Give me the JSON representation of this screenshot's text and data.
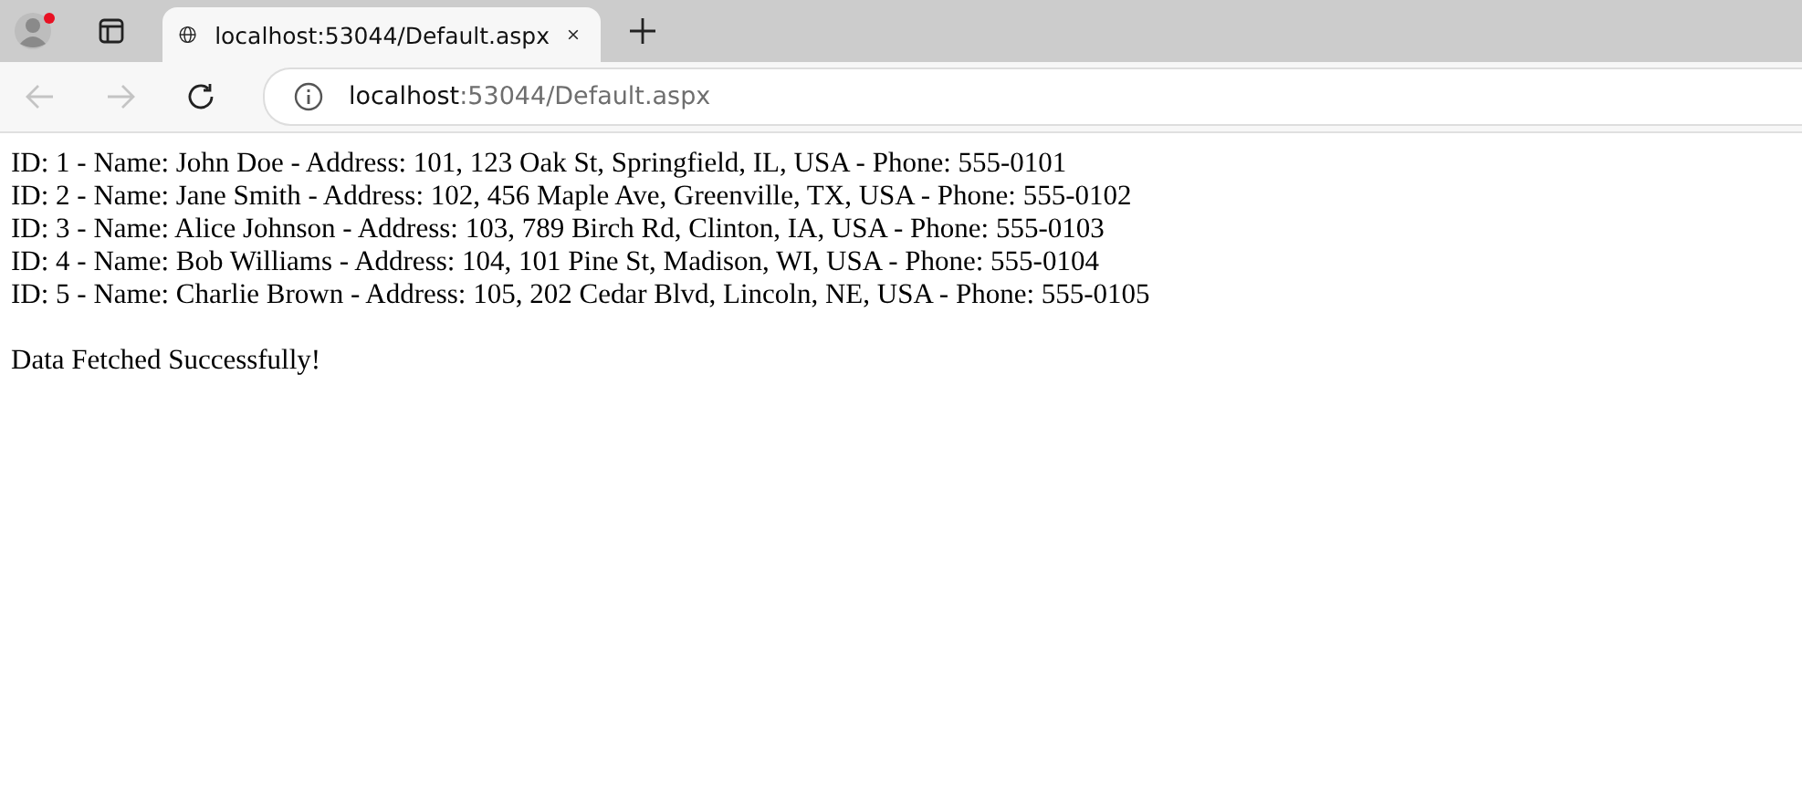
{
  "tab": {
    "title": "localhost:53044/Default.aspx",
    "selected": true
  },
  "toolbar": {
    "back_disabled": true,
    "forward_disabled": true,
    "address_host": "localhost",
    "address_path": ":53044/Default.aspx"
  },
  "page": {
    "lines": [
      "ID: 1 - Name: John Doe - Address: 101, 123 Oak St, Springfield, IL, USA - Phone: 555-0101",
      "ID: 2 - Name: Jane Smith - Address: 102, 456 Maple Ave, Greenville, TX, USA - Phone: 555-0102",
      "ID: 3 - Name: Alice Johnson - Address: 103, 789 Birch Rd, Clinton, IA, USA - Phone: 555-0103",
      "ID: 4 - Name: Bob Williams - Address: 104, 101 Pine St, Madison, WI, USA - Phone: 555-0104",
      "ID: 5 - Name: Charlie Brown - Address: 105, 202 Cedar Blvd, Lincoln, NE, USA - Phone: 555-0105"
    ],
    "status": "Data Fetched Successfully!"
  }
}
